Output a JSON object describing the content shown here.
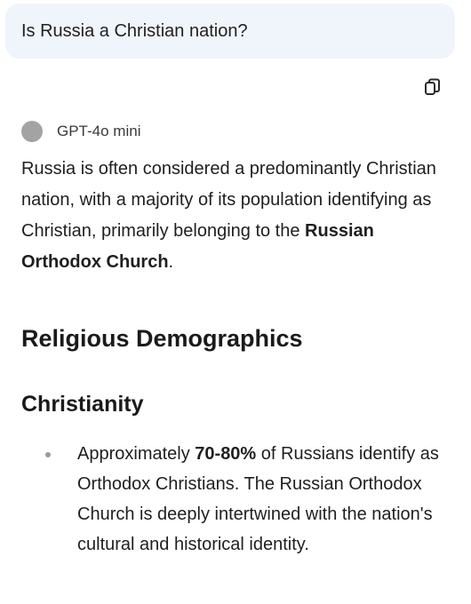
{
  "user_message": "Is Russia a Christian nation?",
  "model": {
    "name": "GPT-4o mini",
    "avatar_color": "#a3a3a3"
  },
  "copy_icon": "copy-icon",
  "answer": {
    "intro_prefix": "Russia is often considered a predominantly Christian nation, with a majority of its population identifying as Christian, primarily belonging to the ",
    "intro_bold": "Russian Orthodox Church",
    "intro_suffix": "."
  },
  "section": {
    "title": "Religious Demographics",
    "subsection": {
      "title": "Christianity",
      "bullets": [
        {
          "prefix": "Approximately ",
          "bold": "70-80%",
          "suffix": " of Russians identify as Orthodox Christians. The Russian Orthodox Church is deeply intertwined with the nation's cultural and historical identity."
        }
      ]
    }
  }
}
